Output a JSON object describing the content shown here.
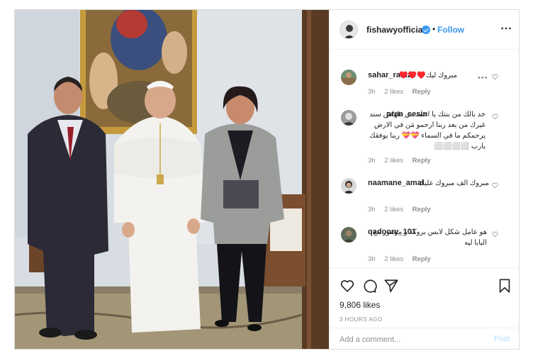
{
  "post": {
    "username": "fishawyofficial",
    "follow_label": "Follow",
    "separator": "•",
    "more_icon": "more-options-icon",
    "verified_icon": "verified-badge-icon"
  },
  "comments": [
    {
      "username": "sahar_ramzii",
      "text": "مبروك ليك♥️♥️♥️",
      "time": "3h",
      "likes": "2 likes",
      "reply": "Reply",
      "options": "•••"
    },
    {
      "username": "pren_sesin",
      "text": "خد بالك من بنتك يا احمد دي طهاش سند غيرك من بعد ربنا ارحمو مَن في الارض يرحمكم ما في السماء 💝💝 ربنا يوفقك يارب ⬜⬜⬜⬜",
      "time": "3h",
      "likes": "2 likes",
      "reply": "Reply"
    },
    {
      "username": "naamane_amal",
      "text": "مبروك الف مبروك عليك",
      "time": "3h",
      "likes": "2 likes",
      "reply": "Reply"
    },
    {
      "username": "qadoory_101",
      "text": "هو عامل شكل لابس بروكة و متصور مع البابا ليه",
      "time": "3h",
      "likes": "2 likes",
      "reply": "Reply"
    }
  ],
  "actions": {
    "like_icon": "heart-icon",
    "comment_icon": "comment-icon",
    "share_icon": "share-icon",
    "save_icon": "bookmark-icon",
    "likes_count": "9,806 likes",
    "timestamp": "3 HOURS AGO"
  },
  "add_comment": {
    "placeholder": "Add a comment...",
    "post_label": "Post"
  },
  "colors": {
    "link_blue": "#3897f0",
    "post_disabled": "#b2dffc",
    "muted": "#8e8e8e",
    "border": "#dbdbdb"
  }
}
